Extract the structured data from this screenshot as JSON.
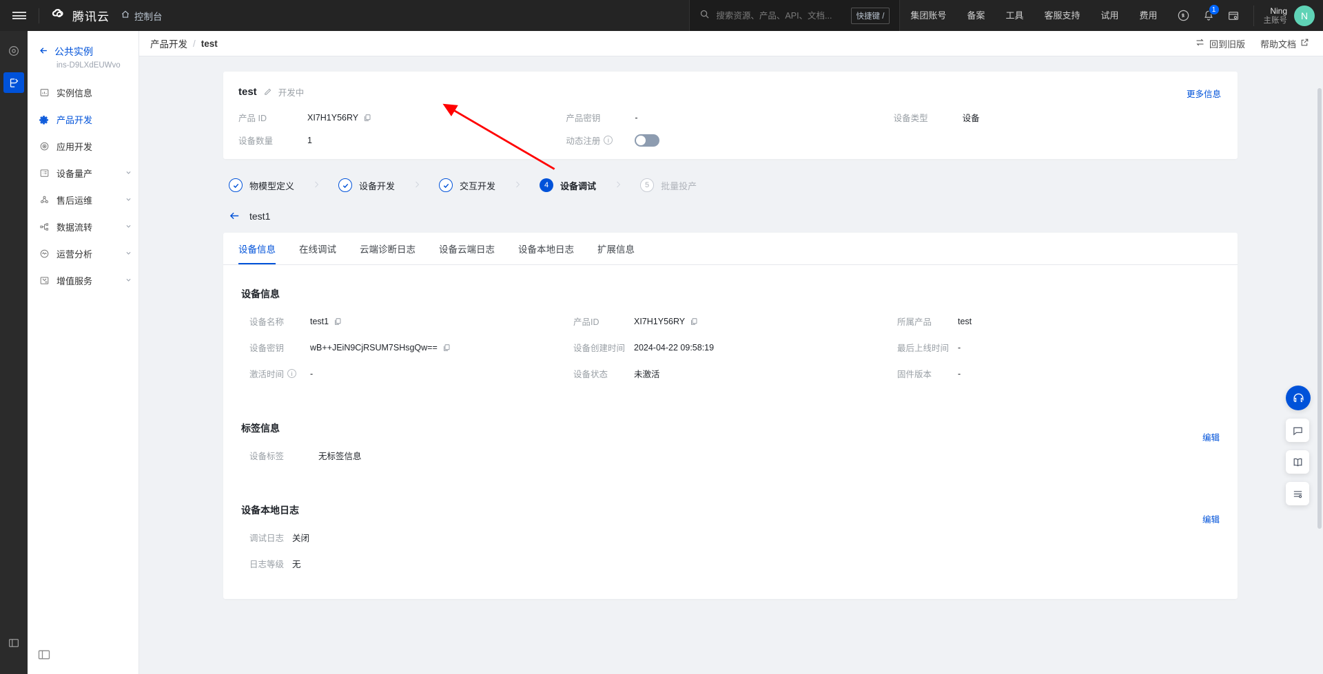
{
  "header": {
    "brand": "腾讯云",
    "console": "控制台",
    "search": {
      "placeholder": "搜索资源、产品、API、文档...",
      "value": "",
      "shortcut": "快捷键 /"
    },
    "nav": [
      "集团账号",
      "备案",
      "工具",
      "客服支持",
      "试用",
      "费用"
    ],
    "notification_count": "1",
    "user": {
      "name": "Ning",
      "role": "主账号",
      "initial": "N"
    },
    "icons": [
      "menu-icon",
      "cloud-logo-icon",
      "home-icon",
      "search-icon",
      "magic-icon",
      "bell-icon",
      "terminal-icon"
    ]
  },
  "rail": {
    "top_icon": "record-icon",
    "active_icon": "iot-icon",
    "bottom_icon": "collapse-icon"
  },
  "sidebar": {
    "instance_name": "公共实例",
    "instance_id": "ins-D9LXdEUWvo",
    "items": [
      {
        "label": "实例信息",
        "icon": "dashboard-icon",
        "active": false,
        "expandable": false
      },
      {
        "label": "产品开发",
        "icon": "gear-icon",
        "active": true,
        "expandable": false
      },
      {
        "label": "应用开发",
        "icon": "target-icon",
        "active": false,
        "expandable": false
      },
      {
        "label": "设备量产",
        "icon": "list-icon",
        "active": false,
        "expandable": true
      },
      {
        "label": "售后运维",
        "icon": "cluster-icon",
        "active": false,
        "expandable": true
      },
      {
        "label": "数据流转",
        "icon": "flow-icon",
        "active": false,
        "expandable": true
      },
      {
        "label": "运营分析",
        "icon": "analytics-icon",
        "active": false,
        "expandable": true
      },
      {
        "label": "增值服务",
        "icon": "service-icon",
        "active": false,
        "expandable": true
      }
    ]
  },
  "breadcrumb": {
    "parent": "产品开发",
    "separator": "/",
    "current": "test",
    "back_to_old": "回到旧版",
    "help_doc": "帮助文档"
  },
  "product_card": {
    "title": "test",
    "status": "开发中",
    "more": "更多信息",
    "fields": [
      {
        "label": "产品 ID",
        "value": "XI7H1Y56RY",
        "copy": true
      },
      {
        "label": "产品密钥",
        "value": "-",
        "copy": false
      },
      {
        "label": "设备类型",
        "value": "设备",
        "copy": false
      },
      {
        "label": "设备数量",
        "value": "1",
        "copy": false
      }
    ],
    "dynamic_register": {
      "label": "动态注册",
      "enabled": false
    }
  },
  "steps": [
    {
      "num": "1",
      "label": "物模型定义",
      "state": "done"
    },
    {
      "num": "2",
      "label": "设备开发",
      "state": "done"
    },
    {
      "num": "3",
      "label": "交互开发",
      "state": "done"
    },
    {
      "num": "4",
      "label": "设备调试",
      "state": "active"
    },
    {
      "num": "5",
      "label": "批量投产",
      "state": "todo"
    }
  ],
  "device": {
    "back_title": "test1",
    "tabs": [
      {
        "label": "设备信息",
        "active": true
      },
      {
        "label": "在线调试",
        "active": false
      },
      {
        "label": "云端诊断日志",
        "active": false
      },
      {
        "label": "设备云端日志",
        "active": false
      },
      {
        "label": "设备本地日志",
        "active": false
      },
      {
        "label": "扩展信息",
        "active": false
      }
    ],
    "section_device_info": {
      "heading": "设备信息",
      "fields": [
        {
          "label": "设备名称",
          "value": "test1",
          "copy": true,
          "muted": false
        },
        {
          "label": "产品ID",
          "value": "XI7H1Y56RY",
          "copy": true,
          "muted": false
        },
        {
          "label": "所属产品",
          "value": "test",
          "copy": false,
          "muted": false
        },
        {
          "label": "设备密钥",
          "value": "wB++JEiN9CjRSUM7SHsgQw==",
          "copy": true,
          "muted": false
        },
        {
          "label": "设备创建时间",
          "value": "2024-04-22 09:58:19",
          "copy": false,
          "muted": false
        },
        {
          "label": "最后上线时间",
          "value": "-",
          "copy": false,
          "muted": false
        },
        {
          "label": "激活时间",
          "value": "-",
          "copy": false,
          "muted": false,
          "info": true
        },
        {
          "label": "设备状态",
          "value": "未激活",
          "copy": false,
          "muted": true
        },
        {
          "label": "固件版本",
          "value": "-",
          "copy": false,
          "muted": false
        }
      ]
    },
    "section_tags": {
      "heading": "标签信息",
      "edit": "编辑",
      "label": "设备标签",
      "value": "无标签信息"
    },
    "section_local_log": {
      "heading": "设备本地日志",
      "edit": "编辑",
      "rows": [
        {
          "label": "调试日志",
          "value": "关闭"
        },
        {
          "label": "日志等级",
          "value": "无"
        }
      ]
    }
  },
  "fabs": [
    "support-chat-icon",
    "feedback-icon",
    "docs-icon",
    "list-panel-icon"
  ],
  "colors": {
    "accent": "#0052d9",
    "header_bg": "#242424",
    "page_bg": "#f0f2f5",
    "annotation": "#ff0000"
  }
}
